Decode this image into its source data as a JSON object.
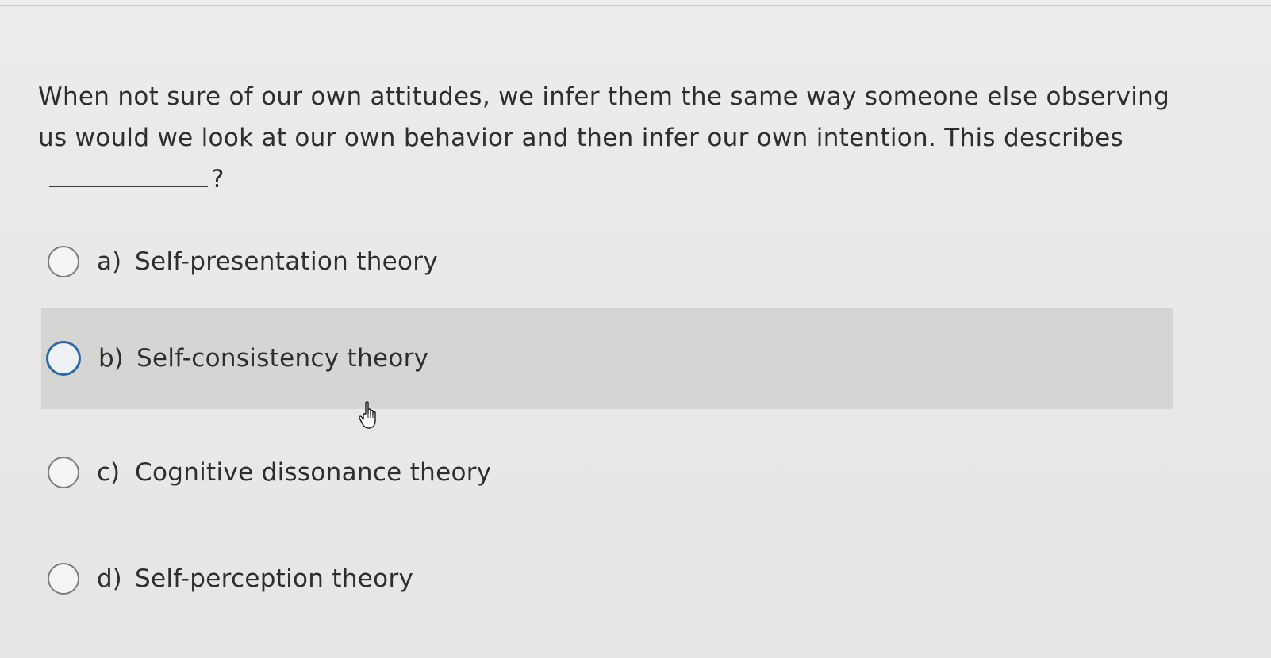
{
  "question": {
    "text_before_blank": "When not sure of our own attitudes, we infer them the same way someone else observing us would we look at our own behavior and then infer our own intention. This describes",
    "text_after_blank": "?"
  },
  "options": [
    {
      "letter": "a)",
      "label": "Self-presentation theory",
      "selected": false,
      "hovered": false
    },
    {
      "letter": "b)",
      "label": "Self-consistency theory",
      "selected": false,
      "hovered": true
    },
    {
      "letter": "c)",
      "label": "Cognitive dissonance theory",
      "selected": false,
      "hovered": false
    },
    {
      "letter": "d)",
      "label": "Self-perception theory",
      "selected": false,
      "hovered": false
    }
  ],
  "colors": {
    "background": "#e9e9e7",
    "hover_row": "#d5d5d3",
    "focus_ring": "#2a6aa6",
    "text": "#2e2e2e"
  },
  "icons": {
    "cursor": "hand-pointer-icon",
    "radio": "radio-button-icon"
  }
}
